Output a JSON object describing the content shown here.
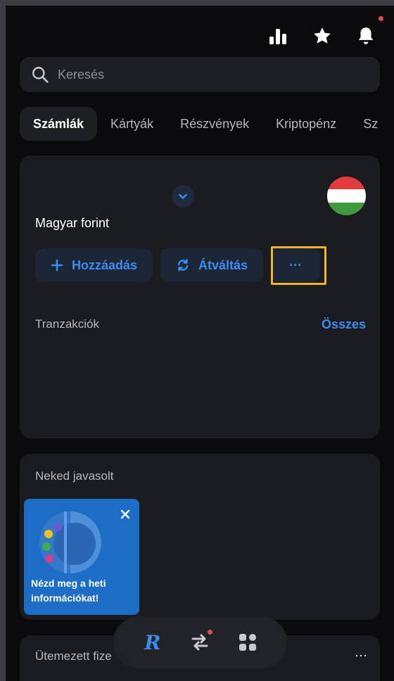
{
  "header": {
    "icons": [
      "analytics-icon",
      "star-icon",
      "bell-icon"
    ],
    "notification_dot_color": "#e5484d"
  },
  "search": {
    "placeholder": "Keresés"
  },
  "tabs": [
    {
      "label": "Számlák",
      "active": true
    },
    {
      "label": "Kártyák"
    },
    {
      "label": "Részvények"
    },
    {
      "label": "Kriptopénz"
    },
    {
      "label": "Sz"
    }
  ],
  "account": {
    "name": "Magyar forint",
    "flag": "hungary-flag",
    "actions": {
      "add_label": "Hozzáadás",
      "exchange_label": "Átváltás",
      "more_label": "···"
    },
    "transactions_label": "Tranzakciók",
    "see_all_label": "Összes"
  },
  "recommended": {
    "title": "Neked javasolt"
  },
  "promo": {
    "text": "Nézd meg a heti információkat!"
  },
  "scheduled": {
    "title": "Ütemezett fize",
    "more_label": "···"
  },
  "bottom_nav": {
    "logo": "R",
    "items": [
      "home-logo-icon",
      "transfers-icon",
      "hub-icon"
    ]
  },
  "colors": {
    "accent": "#3b8cf0",
    "highlight": "#f0b429",
    "promo_bg": "#1d6dc6"
  }
}
